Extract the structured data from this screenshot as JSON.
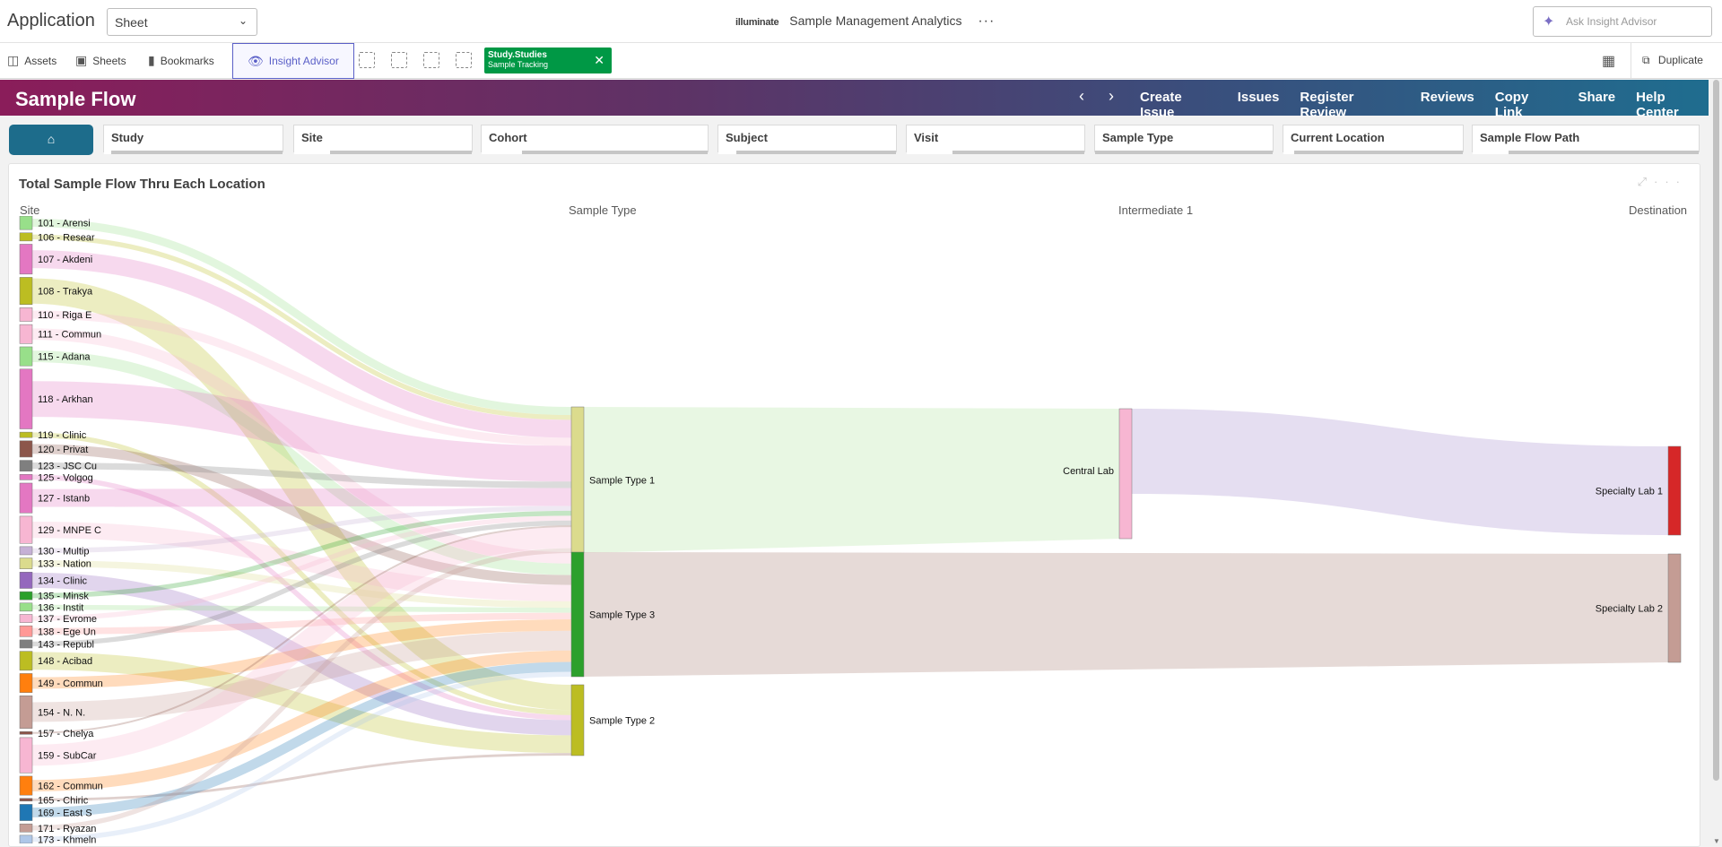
{
  "topbar": {
    "app_label": "Application",
    "sheet_select": "Sheet",
    "brand_logo": "illuminate",
    "app_title": "Sample Management Analytics",
    "more": "···",
    "ask_placeholder": "Ask Insight Advisor"
  },
  "toolbar": {
    "assets": "Assets",
    "sheets": "Sheets",
    "bookmarks": "Bookmarks",
    "insight_advisor": "Insight Advisor",
    "chip_title": "Study.Studies",
    "chip_value": "Sample Tracking",
    "duplicate": "Duplicate"
  },
  "banner": {
    "title": "Sample Flow",
    "links": [
      "Create Issue",
      "Issues",
      "Register Review",
      "Reviews",
      "Copy Link",
      "Share",
      "Help Center"
    ]
  },
  "filters": [
    {
      "label": "Study",
      "sel": 0.04
    },
    {
      "label": "Site",
      "sel": 0.2
    },
    {
      "label": "Cohort",
      "sel": 0.18
    },
    {
      "label": "Subject",
      "sel": 0.1
    },
    {
      "label": "Visit",
      "sel": 0.26
    },
    {
      "label": "Sample Type",
      "sel": 0.0
    },
    {
      "label": "Current Location",
      "sel": 0.06
    },
    {
      "label": "Sample Flow Path",
      "sel": 0.16
    }
  ],
  "panel": {
    "title": "Total Sample Flow Thru Each Location",
    "columns": [
      "Site",
      "Sample Type",
      "Intermediate 1",
      "Destination"
    ]
  },
  "chart_data": {
    "type": "sankey",
    "sites": [
      {
        "label": "101 - Arensi",
        "w": 1,
        "color": "#98df8a",
        "to": 0
      },
      {
        "label": "106 - Resear",
        "w": 0.6,
        "color": "#bcbd22",
        "to": 0
      },
      {
        "label": "107 - Akdeni",
        "w": 2.2,
        "color": "#e377c2",
        "to": 0
      },
      {
        "label": "108 - Trakya",
        "w": 2,
        "color": "#bcbd22",
        "to": 2
      },
      {
        "label": "110 - Riga E",
        "w": 1,
        "color": "#f7b6d2",
        "to": 0
      },
      {
        "label": "111 - Commun",
        "w": 1.4,
        "color": "#f7b6d2",
        "to": 1
      },
      {
        "label": "115 - Adana",
        "w": 1.4,
        "color": "#98df8a",
        "to": 1
      },
      {
        "label": "118 - Arkhan",
        "w": 4.4,
        "color": "#e377c2",
        "to": 0
      },
      {
        "label": "119 - Clinic",
        "w": 0.4,
        "color": "#bcbd22",
        "to": 2
      },
      {
        "label": "120 - Privat",
        "w": 1.2,
        "color": "#8c564b",
        "to": 1
      },
      {
        "label": "123 - JSC Cu",
        "w": 0.8,
        "color": "#7f7f7f",
        "to": 0
      },
      {
        "label": "125 - Volgog",
        "w": 0.4,
        "color": "#e377c2",
        "to": 2
      },
      {
        "label": "127 - Istanb",
        "w": 2.2,
        "color": "#e377c2",
        "to": 0
      },
      {
        "label": "129 - MNPE C",
        "w": 2,
        "color": "#f7b6d2",
        "to": 1
      },
      {
        "label": "130 - Multip",
        "w": 0.6,
        "color": "#c5b0d5",
        "to": 0
      },
      {
        "label": "133 - Nation",
        "w": 0.8,
        "color": "#dbdb8d",
        "to": 1
      },
      {
        "label": "134 - Clinic",
        "w": 1.2,
        "color": "#9467bd",
        "to": 2
      },
      {
        "label": "135 - Minsk",
        "w": 0.6,
        "color": "#2ca02c",
        "to": 0
      },
      {
        "label": "136 - Instit",
        "w": 0.6,
        "color": "#98df8a",
        "to": 1
      },
      {
        "label": "137 - Evrome",
        "w": 0.6,
        "color": "#f7b6d2",
        "to": 0
      },
      {
        "label": "138 - Ege Un",
        "w": 0.8,
        "color": "#ff9896",
        "to": 1
      },
      {
        "label": "143 - Republ",
        "w": 0.6,
        "color": "#7f7f7f",
        "to": 0
      },
      {
        "label": "148 - Acibad",
        "w": 1.4,
        "color": "#bcbd22",
        "to": 2
      },
      {
        "label": "149 - Commun",
        "w": 1.4,
        "color": "#ff7f0e",
        "to": 1
      },
      {
        "label": "154 - N. N.",
        "w": 2.4,
        "color": "#c49c94",
        "to": 1
      },
      {
        "label": "157 - Chelya",
        "w": 0.2,
        "color": "#8c564b",
        "to": 0
      },
      {
        "label": "159 - SubCar",
        "w": 2.6,
        "color": "#f7b6d2",
        "to": 0
      },
      {
        "label": "162 - Commun",
        "w": 1.4,
        "color": "#ff7f0e",
        "to": 1
      },
      {
        "label": "165 - Chiric",
        "w": 0.2,
        "color": "#8c564b",
        "to": 2
      },
      {
        "label": "169 - East S",
        "w": 1.2,
        "color": "#1f77b4",
        "to": 1
      },
      {
        "label": "171 - Ryazan",
        "w": 0.6,
        "color": "#c49c94",
        "to": 0
      },
      {
        "label": "173 - Khmeln",
        "w": 0.6,
        "color": "#aec7e8",
        "to": 1
      }
    ],
    "sample_types": [
      {
        "label": "Sample Type 1",
        "color": "#dbdb8d"
      },
      {
        "label": "Sample Type 3",
        "color": "#2ca02c"
      },
      {
        "label": "Sample Type 2",
        "color": "#bcbd22"
      }
    ],
    "intermediate": [
      {
        "label": "Central Lab",
        "color": "#f7b6d2"
      }
    ],
    "destinations": [
      {
        "label": "Specialty Lab 1",
        "color": "#d62728"
      },
      {
        "label": "Specialty Lab 2",
        "color": "#c49c94"
      }
    ],
    "link_colors": {
      "st1_to_central": "#d8f2d0",
      "st3_to_lab2": "#dccbc6",
      "central_to_lab1": "#dcd3ec"
    }
  }
}
